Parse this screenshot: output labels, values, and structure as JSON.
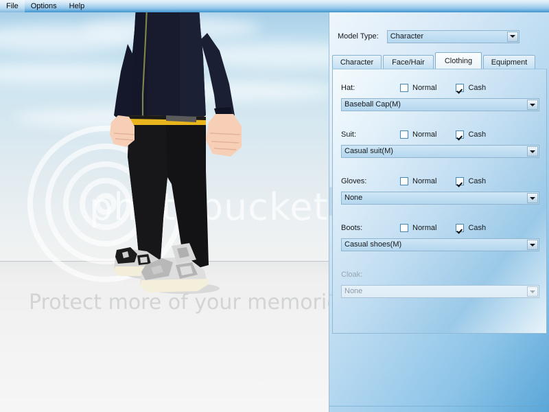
{
  "window": {
    "menu": [
      {
        "label": "File"
      },
      {
        "label": "Options"
      },
      {
        "label": "Help"
      }
    ]
  },
  "viewport": {
    "watermark_logo_text": "photobucket",
    "watermark_tagline": "Protect more of your memories for less!",
    "background": "sky-gradient-with-clouds",
    "character": {
      "jacket_color": "#16182b",
      "belt_color": "#e8b51d",
      "pants_color": "#131315",
      "skin_color": "#f6cdb4",
      "shoe_color": "#d2d2d2"
    }
  },
  "panel": {
    "model_type": {
      "label": "Model Type:",
      "value": "Character",
      "icon": "chevron-down-icon"
    },
    "tabs": [
      {
        "label": "Character",
        "active": false
      },
      {
        "label": "Face/Hair",
        "active": false
      },
      {
        "label": "Clothing",
        "active": true
      },
      {
        "label": "Equipment",
        "active": false
      }
    ],
    "clothing": {
      "groups": [
        {
          "name": "Hat:",
          "normal_label": "Normal",
          "normal_checked": false,
          "cash_label": "Cash",
          "cash_checked": true,
          "value": "Baseball Cap(M)",
          "disabled": false
        },
        {
          "name": "Suit:",
          "normal_label": "Normal",
          "normal_checked": false,
          "cash_label": "Cash",
          "cash_checked": true,
          "value": "Casual suit(M)",
          "disabled": false
        },
        {
          "name": "Gloves:",
          "normal_label": "Normal",
          "normal_checked": false,
          "cash_label": "Cash",
          "cash_checked": true,
          "value": "None",
          "disabled": false
        },
        {
          "name": "Boots:",
          "normal_label": "Normal",
          "normal_checked": false,
          "cash_label": "Cash",
          "cash_checked": true,
          "value": "Casual shoes(M)",
          "disabled": false
        },
        {
          "name": "Cloak:",
          "value": "None",
          "disabled": true
        }
      ]
    },
    "watermark_fragment_1": "bucket",
    "watermark_fragment_2": "mories for less!",
    "accent_color": "#4a9ad4"
  }
}
